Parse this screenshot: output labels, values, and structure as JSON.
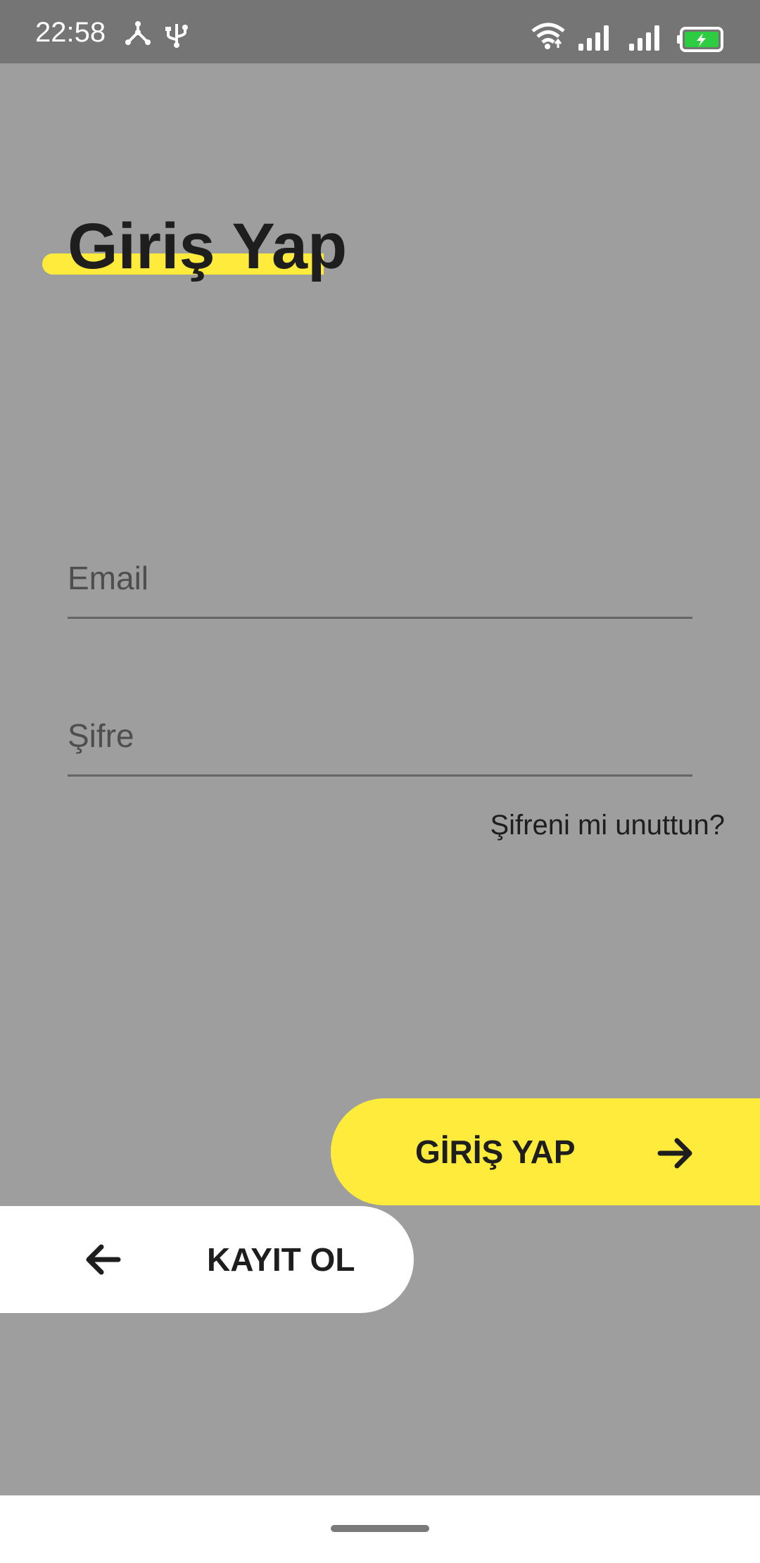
{
  "status_bar": {
    "time": "22:58",
    "icons": [
      "nodes-icon",
      "usb-icon",
      "wifi-icon",
      "signal-icon",
      "signal-icon",
      "battery-charging-icon"
    ]
  },
  "page": {
    "title": "Giriş Yap"
  },
  "form": {
    "email_placeholder": "Email",
    "password_placeholder": "Şifre",
    "forgot_password": "Şifreni mi unuttun?"
  },
  "actions": {
    "login_label": "GİRİŞ YAP",
    "register_label": "KAYIT OL"
  },
  "colors": {
    "accent": "#ffeb3b",
    "background": "#9e9e9e",
    "status_bar": "#757575",
    "text": "#1e1e1e"
  }
}
